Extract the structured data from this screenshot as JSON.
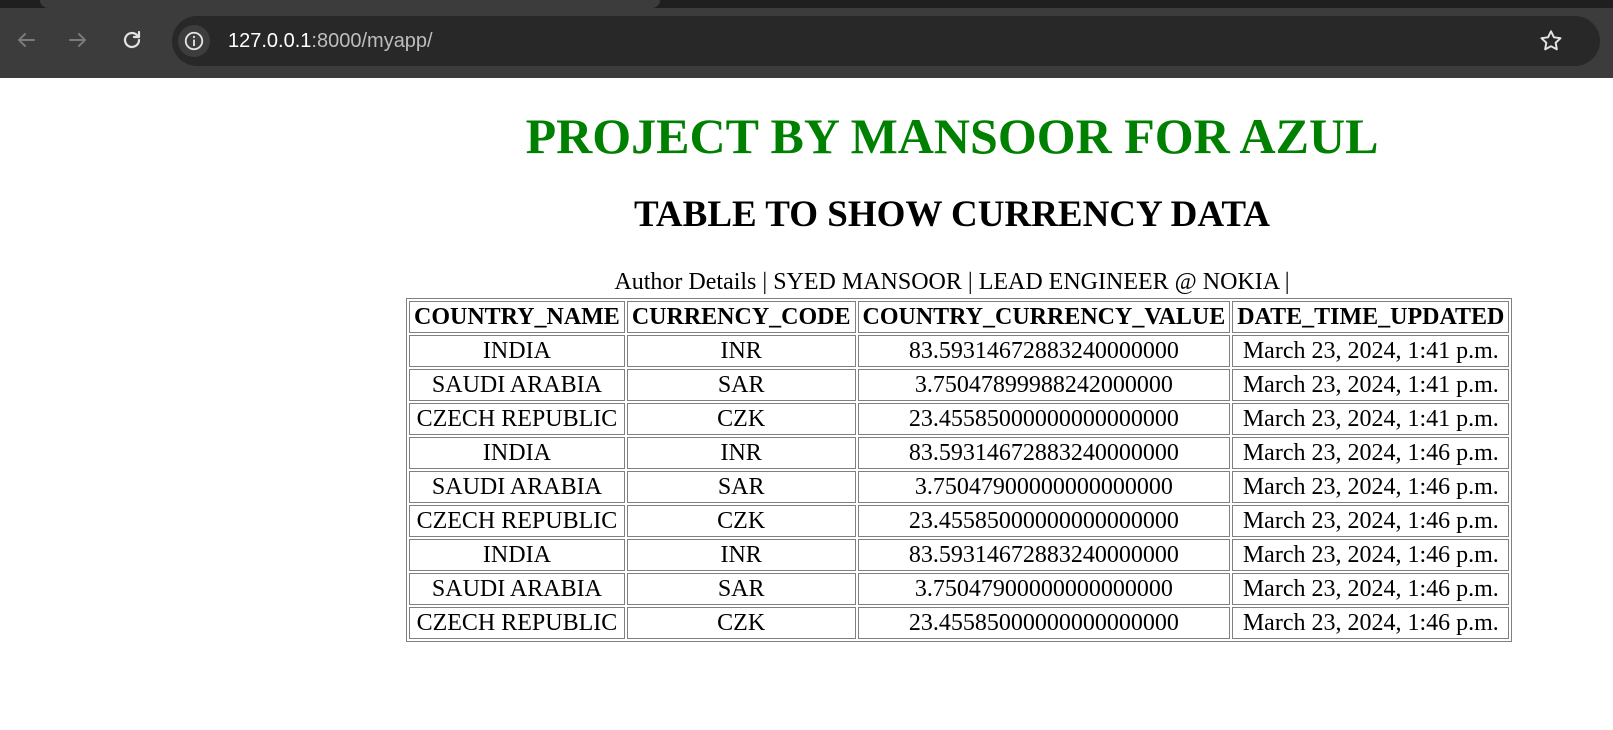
{
  "browser": {
    "url_host": "127.0.0.1",
    "url_rest": ":8000/myapp/"
  },
  "page": {
    "title": "PROJECT BY MANSOOR FOR AZUL",
    "subtitle": "TABLE TO SHOW CURRENCY DATA",
    "author_line": "Author Details | SYED MANSOOR | LEAD ENGINEER @ NOKIA |",
    "title_color": "#008000"
  },
  "table": {
    "headers": [
      "COUNTRY_NAME",
      "CURRENCY_CODE",
      "COUNTRY_CURRENCY_VALUE",
      "DATE_TIME_UPDATED"
    ],
    "rows": [
      [
        "INDIA",
        "INR",
        "83.59314672883240000000",
        "March 23, 2024, 1:41 p.m."
      ],
      [
        "SAUDI ARABIA",
        "SAR",
        "3.75047899988242000000",
        "March 23, 2024, 1:41 p.m."
      ],
      [
        "CZECH REPUBLIC",
        "CZK",
        "23.45585000000000000000",
        "March 23, 2024, 1:41 p.m."
      ],
      [
        "INDIA",
        "INR",
        "83.59314672883240000000",
        "March 23, 2024, 1:46 p.m."
      ],
      [
        "SAUDI ARABIA",
        "SAR",
        "3.75047900000000000000",
        "March 23, 2024, 1:46 p.m."
      ],
      [
        "CZECH REPUBLIC",
        "CZK",
        "23.45585000000000000000",
        "March 23, 2024, 1:46 p.m."
      ],
      [
        "INDIA",
        "INR",
        "83.59314672883240000000",
        "March 23, 2024, 1:46 p.m."
      ],
      [
        "SAUDI ARABIA",
        "SAR",
        "3.75047900000000000000",
        "March 23, 2024, 1:46 p.m."
      ],
      [
        "CZECH REPUBLIC",
        "CZK",
        "23.45585000000000000000",
        "March 23, 2024, 1:46 p.m."
      ]
    ]
  }
}
